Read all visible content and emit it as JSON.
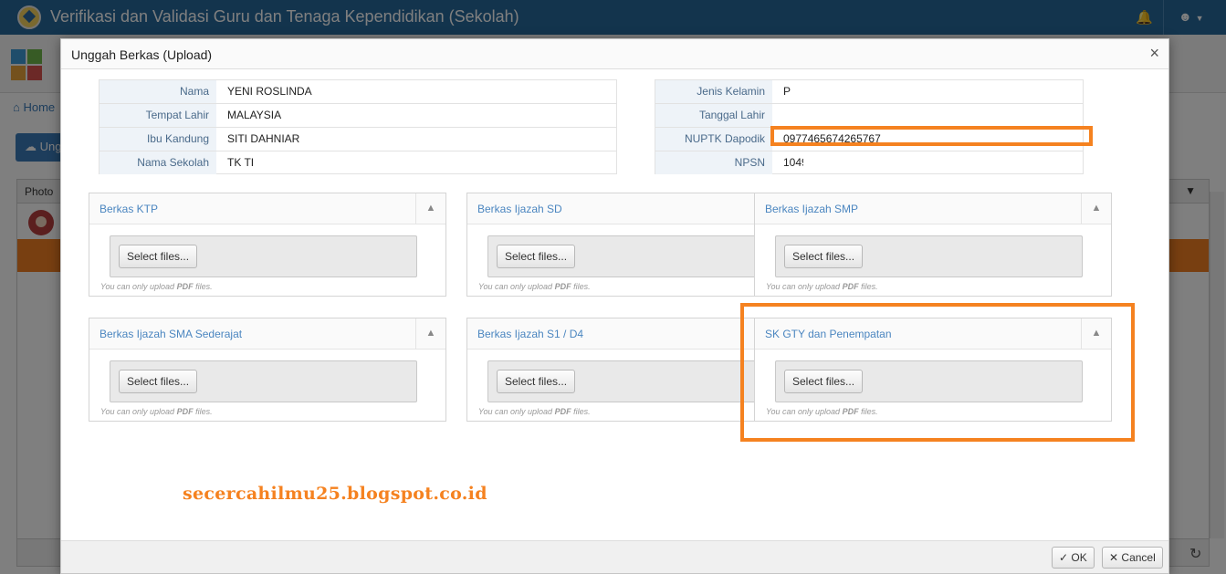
{
  "app": {
    "title": "Verifikasi dan Validasi Guru dan Tenaga Kependidikan (Sekolah)",
    "breadcrumb_home": "Home",
    "upload_button_partial": "Ung",
    "grid_photo_header": "Photo"
  },
  "modal": {
    "title": "Unggah Berkas (Upload)",
    "close_label": "×",
    "ok_label": "OK",
    "cancel_label": "Cancel"
  },
  "info_left": [
    {
      "label": "Nama",
      "value": "YENI ROSLINDA"
    },
    {
      "label": "Tempat Lahir",
      "value": "MALAYSIA"
    },
    {
      "label": "Ibu Kandung",
      "value": "SITI DAHNIAR"
    },
    {
      "label": "Nama Sekolah",
      "value": "TK TI"
    }
  ],
  "info_right": [
    {
      "label": "Jenis Kelamin",
      "value": "P"
    },
    {
      "label": "Tanggal Lahir",
      "value": ""
    },
    {
      "label": "NUPTK Dapodik",
      "value": "0977465674265767"
    },
    {
      "label": "NPSN",
      "value": "1049"
    }
  ],
  "panels": [
    {
      "title": "Berkas KTP",
      "button": "Select files...",
      "hint_pre": "You can only upload ",
      "hint_bold": "PDF",
      "hint_post": " files."
    },
    {
      "title": "Berkas Ijazah SD",
      "button": "Select files...",
      "hint_pre": "You can only upload ",
      "hint_bold": "PDF",
      "hint_post": " files."
    },
    {
      "title": "Berkas Ijazah SMP",
      "button": "Select files...",
      "hint_pre": "You can only upload ",
      "hint_bold": "PDF",
      "hint_post": " files."
    },
    {
      "title": "Berkas Ijazah SMA Sederajat",
      "button": "Select files...",
      "hint_pre": "You can only upload ",
      "hint_bold": "PDF",
      "hint_post": " files."
    },
    {
      "title": "Berkas Ijazah S1 / D4",
      "button": "Select files...",
      "hint_pre": "You can only upload ",
      "hint_bold": "PDF",
      "hint_post": " files."
    },
    {
      "title": "SK GTY dan Penempatan",
      "button": "Select files...",
      "hint_pre": "You can only upload ",
      "hint_bold": "PDF",
      "hint_post": " files."
    }
  ],
  "watermark": "secercahilmu25.blogspot.co.id",
  "colors": {
    "topbar": "#27689b",
    "highlight": "#f58220",
    "panel_title": "#4b86c0",
    "selected_row": "#f07f23"
  },
  "icons": {
    "bell": "bell-icon",
    "user": "user-icon",
    "home": "home-icon",
    "cloud_upload": "cloud-upload-icon",
    "filter": "filter-icon",
    "chevron_up": "chevron-up-icon",
    "check": "check-icon",
    "close": "close-icon",
    "refresh": "refresh-icon"
  }
}
